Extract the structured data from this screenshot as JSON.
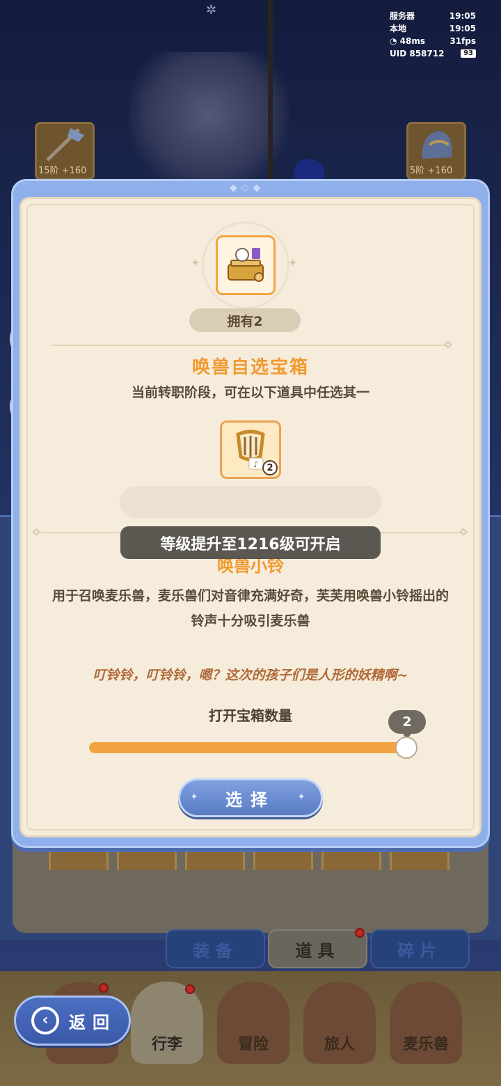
{
  "status": {
    "server_label": "服务器",
    "server_time": "19:05",
    "local_label": "本地",
    "local_time": "19:05",
    "ping": "48ms",
    "fps": "31fps",
    "uid_label": "UID",
    "uid": "858712",
    "battery": "93"
  },
  "background": {
    "left_slot_tier": "15阶 +160",
    "right_slot_tier": "5阶 +160"
  },
  "side": {
    "notification_count": "1"
  },
  "modal": {
    "owned": "拥有2",
    "box_title": "唤兽自选宝箱",
    "box_desc": "当前转职阶段，可在以下道具中任选其一",
    "item_count": "2",
    "item_name": "唤兽小铃",
    "item_desc": "用于召唤麦乐兽，麦乐兽们对音律充满好奇，芙芙用唤兽小铃摇出的铃声十分吸引麦乐兽",
    "item_quote": "叮铃铃，叮铃铃，嗯？这次的孩子们是人形的妖精啊~",
    "qty_label": "打开宝箱数量",
    "qty_value": "2",
    "qty_fraction": 1.0,
    "select_label": "选择"
  },
  "toast": "等级提升至1216级可开启",
  "tabs": [
    {
      "label": "装备"
    },
    {
      "label": "道具"
    },
    {
      "label": "碎片"
    }
  ],
  "nav": [
    {
      "label": "行李"
    },
    {
      "label": "冒险"
    },
    {
      "label": "旅人"
    },
    {
      "label": "麦乐兽"
    }
  ],
  "back_label": "返回",
  "colors": {
    "accent_orange": "#f09a2f",
    "panel_blue": "#8fb0ea",
    "button_blue": "#5a7cc4"
  }
}
